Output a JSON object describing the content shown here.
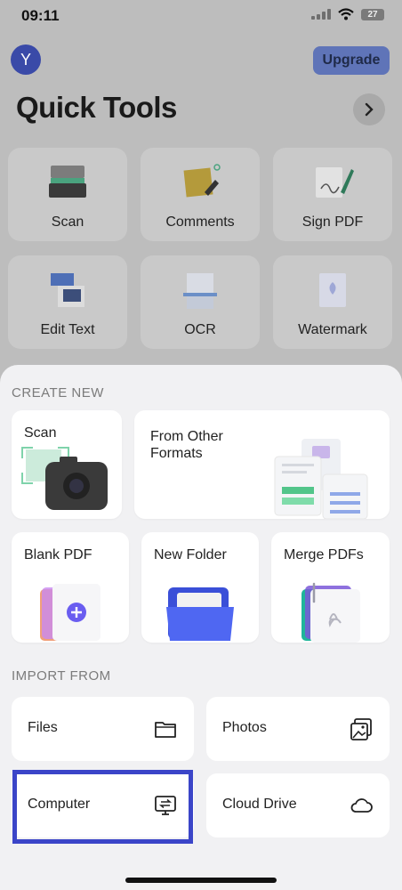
{
  "status": {
    "time": "09:11",
    "battery": "27"
  },
  "header": {
    "avatar_letter": "Y",
    "upgrade_label": "Upgrade",
    "title": "Quick Tools"
  },
  "quick_tools": [
    {
      "label": "Scan",
      "icon": "scanner-icon"
    },
    {
      "label": "Comments",
      "icon": "sticky-note-icon"
    },
    {
      "label": "Sign PDF",
      "icon": "sign-pen-icon"
    },
    {
      "label": "Edit Text",
      "icon": "edit-text-icon"
    },
    {
      "label": "OCR",
      "icon": "ocr-icon"
    },
    {
      "label": "Watermark",
      "icon": "watermark-icon"
    }
  ],
  "create_new": {
    "heading": "CREATE NEW",
    "scan": "Scan",
    "from_other_line1": "From Other",
    "from_other_line2": "Formats",
    "blank_pdf": "Blank PDF",
    "new_folder": "New Folder",
    "merge_pdfs": "Merge PDFs"
  },
  "import_from": {
    "heading": "IMPORT FROM",
    "files": "Files",
    "photos": "Photos",
    "computer": "Computer",
    "cloud_drive": "Cloud Drive"
  },
  "colors": {
    "highlight": "#3b45c8",
    "accent": "#5f74b8"
  }
}
